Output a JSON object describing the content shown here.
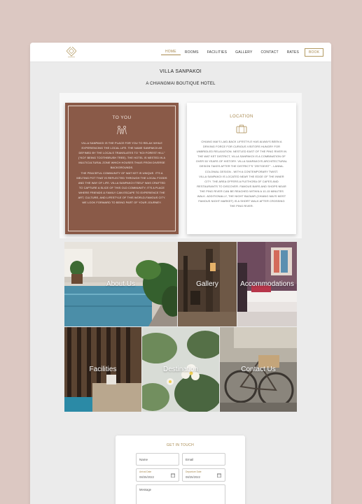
{
  "brand": {
    "logo_icon": "villa-logo-icon",
    "accent": "#a8894f",
    "brown": "#8a5a48"
  },
  "nav": {
    "items": [
      "HOME",
      "ROOMS",
      "FACILITIES",
      "GALLERY",
      "CONTACT",
      "RATES"
    ],
    "active": "HOME",
    "book_label": "BOOK"
  },
  "header": {
    "title": "VILLA SANPAKOI",
    "subtitle": "A CHIANGMAI BOUTIQUE HOTEL"
  },
  "to_you": {
    "heading": "TO YOU",
    "icon": "family-icon",
    "paragraph1": "VILLA SANPAKOI IS THE PLACE FOR YOU TO RELAX WHILE EXPERIENCING THE LOCAL LIFE. THE NAME SANPAKOI AS DEFINED BY THE LOCALS TRANSLATES TO \"KOI FOREST HILL\" (\"KOI\" BEING TOOTHBRUSH TREE). THE HOTEL IS NESTED IN A MULTICULTURAL ZONE WHICH HOUSES THAIS FROM DIVERSE BACKGROUNDS.",
    "paragraph2": "THE PEACEFUL COMMUNITY OF WAT KET IS UNIQUE. IT'S A MELTING POT THAT IS REFLECTED THROUGH THE LOCAL FOODS AND THE WAY OF LIFE. VILLA SANPAKOI ITSELF WAS CRAFTED TO CAPTURE A SLICE OF THIS OLD COMMUNITY; IT'S A PLACE WHERE FRIENDS & FAMILY CAN ESCAPE TO EXPERIENCE THE ART, CULTURE, AND LIFESTYLE OF THIS WORLD-FAMOUS CITY. WE LOOK FORWARD TO BEING PART OF YOUR JOURNEY."
  },
  "location": {
    "heading": "LOCATION",
    "icon": "suitcase-icon",
    "paragraph1": "CHIANG MAI'S LAID-BACK LIFESTYLE HAS ALWAYS BEEN A DRIVING FORCE FOR CURIOUS VISITORS HUNGRY FOR UNBRIDLED RELAXATION. NESTLED EAST OF THE PING RIVER IN THE WAT KET DISTRICT, VILLA SANPAKOI IS A COMBINATION OF OVER 50 YEARS OF HISTORY. VILLA SANPAKOI'S ARCHITECTURAL DESIGN TAKES AFTER THE DISTRICT'S \"ZEITGEIST\" - LANNA-COLONIAL DESIGN - WITH A CONTEMPORARY TWIST.",
    "paragraph2": "VILLA SANPAKOI IS LOCATED NEAR THE EDGE OF THE INNER CITY. THE AREA OFFERS A PLETHORA OF CAFES AND RESTAURANTS TO DISCOVER. FAMOUS BARS AND SHOPS NEAR THE PING RIVER CAN BE REACHED WITHIN A 10-15 MINUTES WALK. ADDITIONALLY, THE NIGHT BAZAAR (CHIANG MAI'S MOST FAMOUS NIGHT MARKET) IS A SHORT WALK AFTER CROSSING THE PING RIVER."
  },
  "tiles": [
    "About Us",
    "Gallery",
    "Accommodations",
    "Facilities",
    "Destination",
    "Contact Us"
  ],
  "form": {
    "heading": "GET IN TOUCH",
    "name_placeholder": "Name",
    "email_placeholder": "Email",
    "arrival_label": "Arrival Date",
    "arrival_value": "08/25/2022",
    "departure_label": "Departure Date",
    "departure_value": "08/25/2022",
    "message_placeholder": "Message"
  }
}
